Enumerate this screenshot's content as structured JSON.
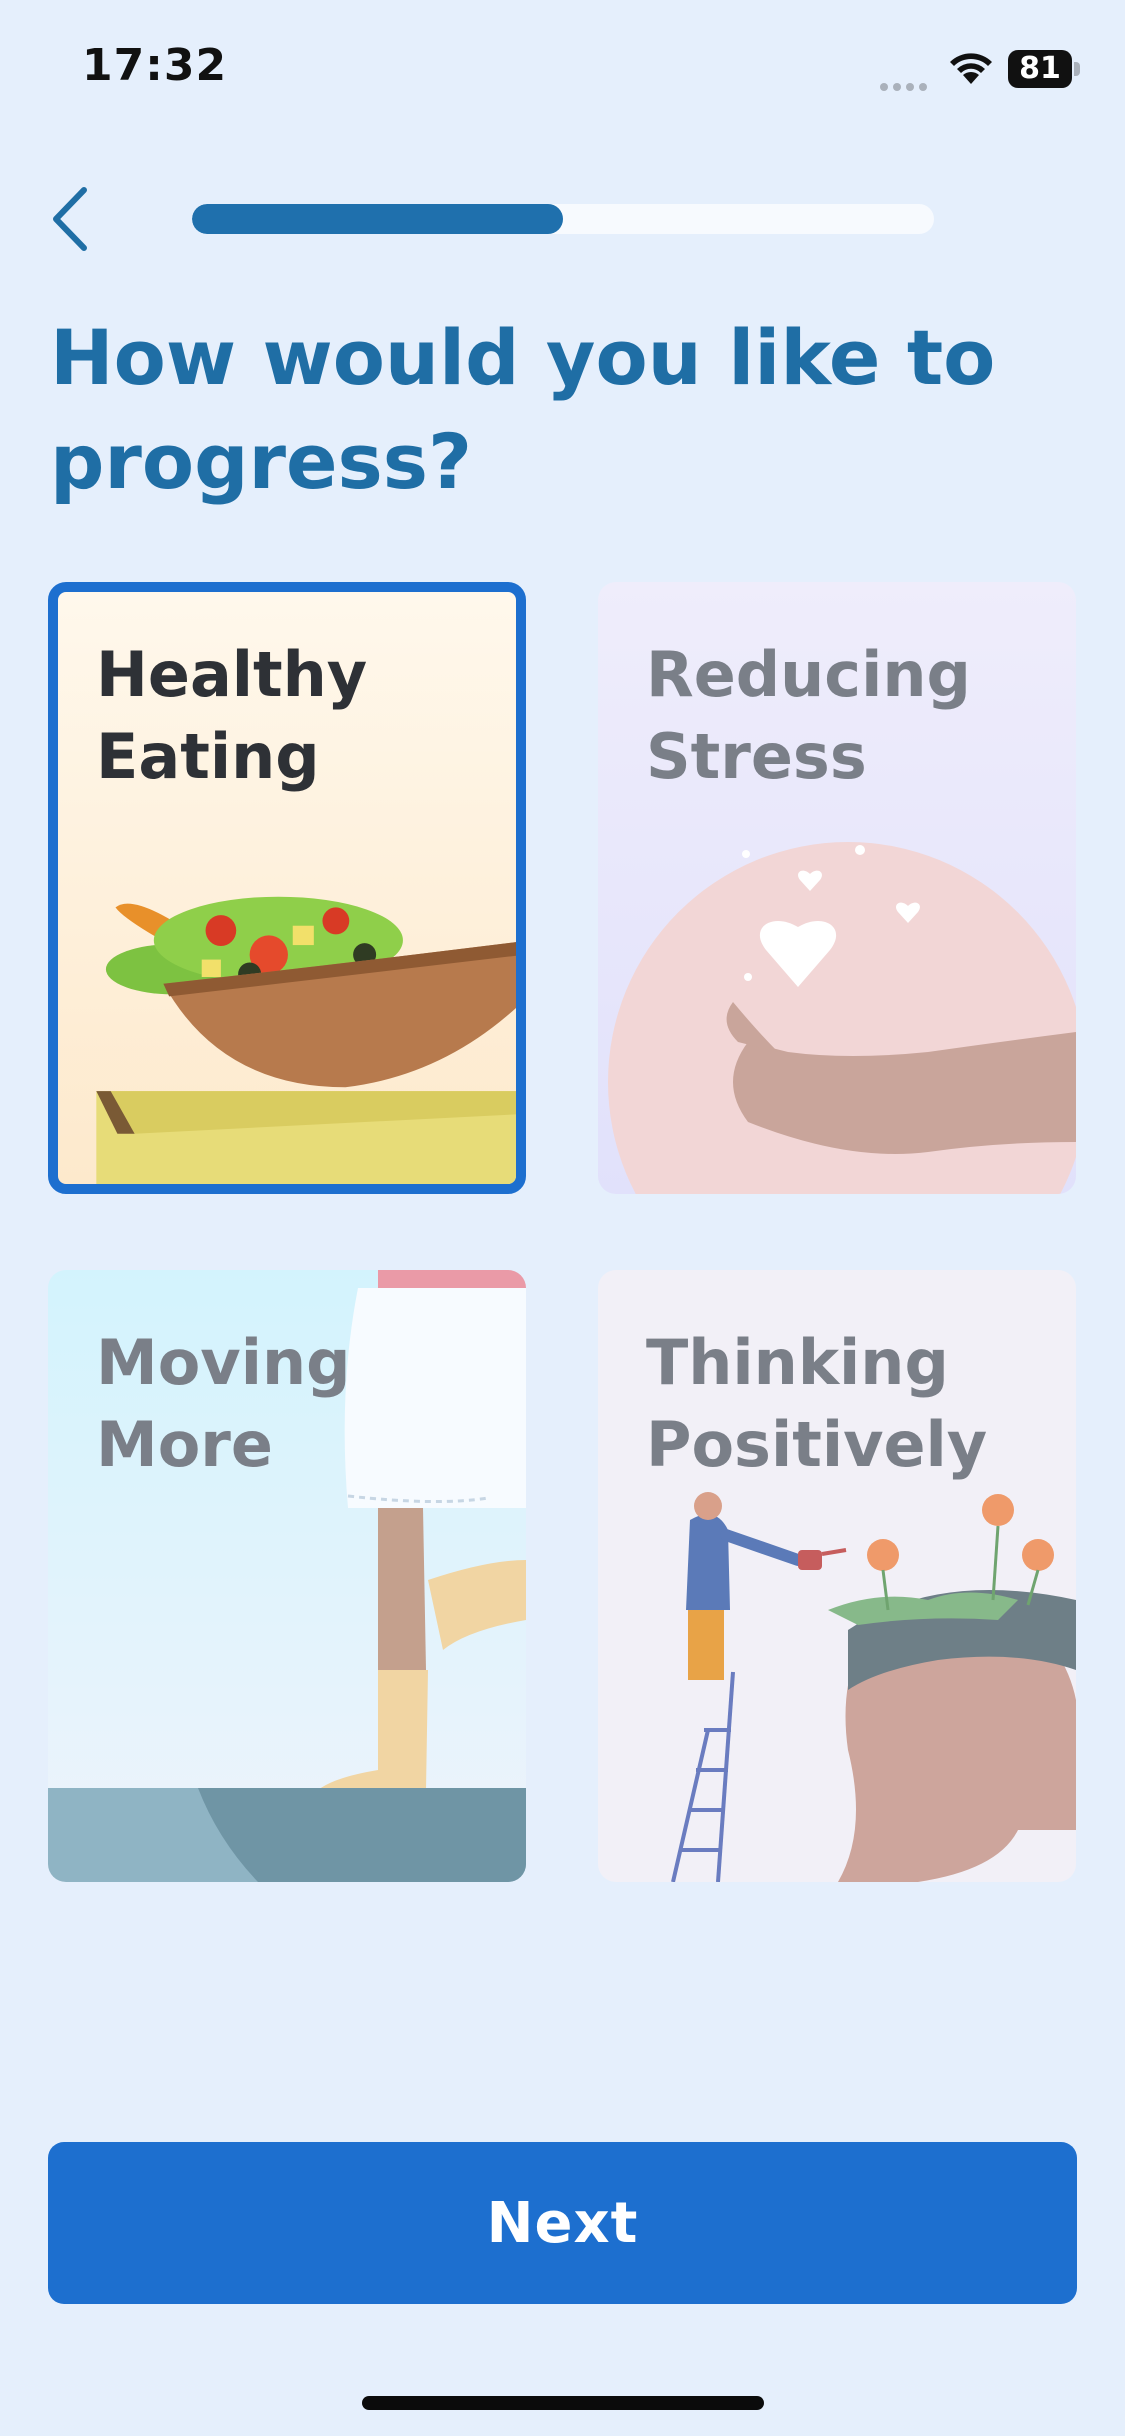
{
  "status_bar": {
    "time": "17:32",
    "battery": "81"
  },
  "header": {
    "progress_fraction": 0.5
  },
  "title": "How would you like to progress?",
  "options": [
    {
      "label": "Healthy Eating",
      "selected": true,
      "icon": "salad-bowl-illustration"
    },
    {
      "label": "Reducing Stress",
      "selected": false,
      "icon": "hand-hearts-illustration"
    },
    {
      "label": "Moving More",
      "selected": false,
      "icon": "walking-legs-illustration"
    },
    {
      "label": "Thinking Positively",
      "selected": false,
      "icon": "watering-head-illustration"
    }
  ],
  "footer": {
    "next_label": "Next"
  },
  "colors": {
    "accent": "#1d6fcf",
    "title": "#1f6ea5",
    "background": "#e5effc"
  }
}
